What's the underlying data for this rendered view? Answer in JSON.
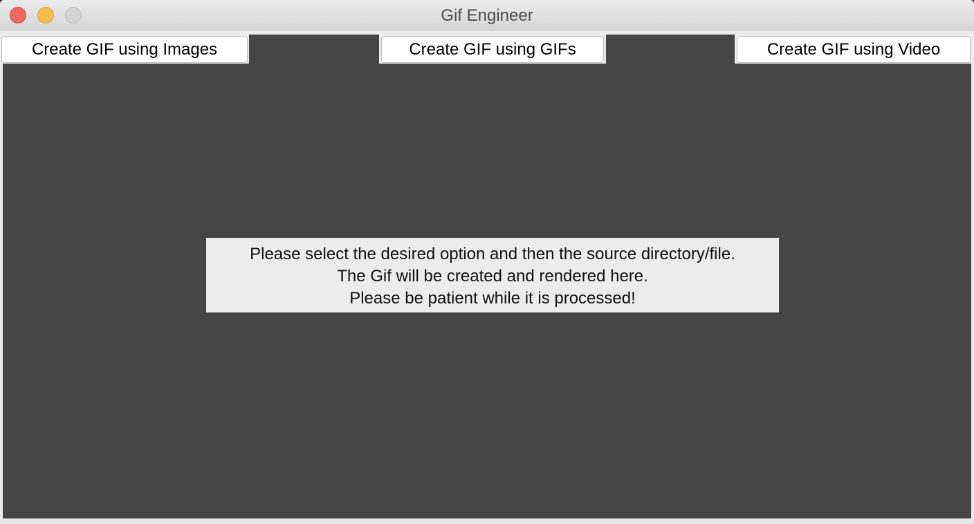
{
  "window": {
    "title": "Gif Engineer"
  },
  "toolbar": {
    "images_button": "Create GIF using Images",
    "gifs_button": "Create GIF using GIFs",
    "video_button": "Create GIF using Video"
  },
  "message": {
    "line1": "Please select the desired option and then the source directory/file.",
    "line2": "The Gif will be created and rendered here.",
    "line3": "Please be patient while it is processed!"
  },
  "colors": {
    "content_background": "#454545",
    "close": "#ed6a5e",
    "minimize": "#f5bf4f",
    "zoom": "#d4d4d4"
  }
}
